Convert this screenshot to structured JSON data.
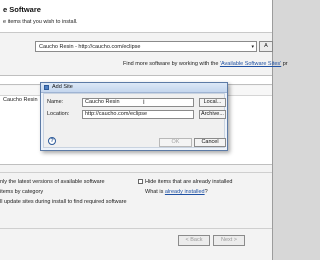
{
  "main": {
    "title": "e Software",
    "subtitle": "e items that you wish to install.",
    "work_with_combo": "Caucho Resin - http://caucho.com/eclipse",
    "combo_arrow": "▾",
    "add_button": "A",
    "find_more_prefix": "Find more software by working with the ",
    "find_more_link": "'Available Software Sites'",
    "find_more_suffix": " pr",
    "list_item": "Caucho Resin",
    "options": {
      "latest_versions": "nly the latest versions of available software",
      "group_by_category": "items by category",
      "contact_all_sites": "ll update sites during install to find required software",
      "hide_installed": "Hide items that are already installed",
      "what_is_prefix": "What is ",
      "what_is_link": "already installed",
      "what_is_suffix": "?"
    },
    "buttons": {
      "back": "< Back",
      "next": "Next >"
    }
  },
  "dialog": {
    "title": "Add Site",
    "name_label": "Name:",
    "name_value": "Caucho Resin",
    "location_label": "Location:",
    "location_value": "http://caucho.com/eclipse",
    "local_button": "Local...",
    "archive_button": "Archive...",
    "ok_button": "OK",
    "cancel_button": "Cancel",
    "help_icon": "?"
  }
}
